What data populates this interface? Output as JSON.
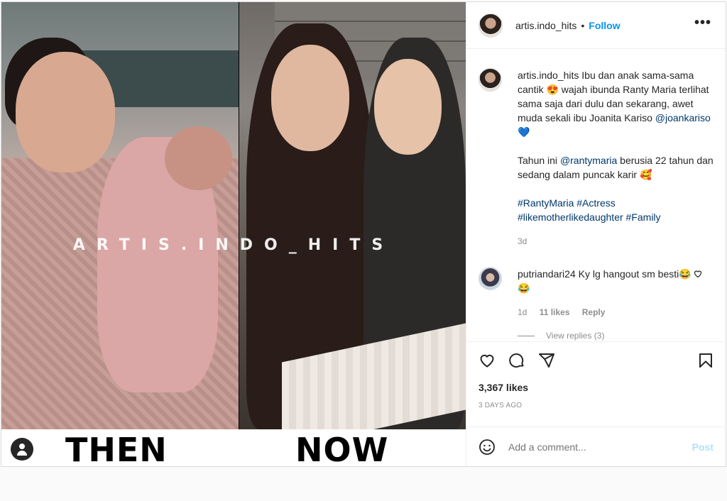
{
  "media": {
    "watermark": "ARTIS.INDO_HITS",
    "left_label": "THEN",
    "right_label": "NOW"
  },
  "header": {
    "username": "artis.indo_hits",
    "separator": "•",
    "follow_label": "Follow",
    "more_label": "•••"
  },
  "caption": {
    "username": "artis.indo_hits",
    "line1": " Ibu dan anak sama-sama cantik 😍 wajah ibunda Ranty Maria terlihat sama saja dari dulu dan sekarang, awet muda sekali ibu Joanita Kariso ",
    "mention1": "@joankariso",
    "line1_end": " 💙",
    "para2_start": "Tahun ini ",
    "mention2": "@rantymaria",
    "para2_end": " berusia 22 tahun dan sedang dalam puncak karir 🥰",
    "hashtag1": "#RantyMaria",
    "hashtag2": "#Actress",
    "hashtag3": "#likemotherlikedaughter",
    "hashtag4": "#Family",
    "time": "3d"
  },
  "comment": {
    "username": "putriandari24",
    "text": " Ky lg hangout sm besti😂😂",
    "time": "1d",
    "likes": "11 likes",
    "reply_label": "Reply",
    "view_replies": "View replies (3)"
  },
  "actions": {
    "likes": "3,367 likes",
    "ago": "3 DAYS AGO"
  },
  "add_comment": {
    "placeholder": "Add a comment...",
    "post_label": "Post"
  },
  "colors": {
    "accent": "#0095f6",
    "post_disabled": "#b2dffc",
    "link": "#00376b",
    "muted": "#8e8e8e"
  }
}
